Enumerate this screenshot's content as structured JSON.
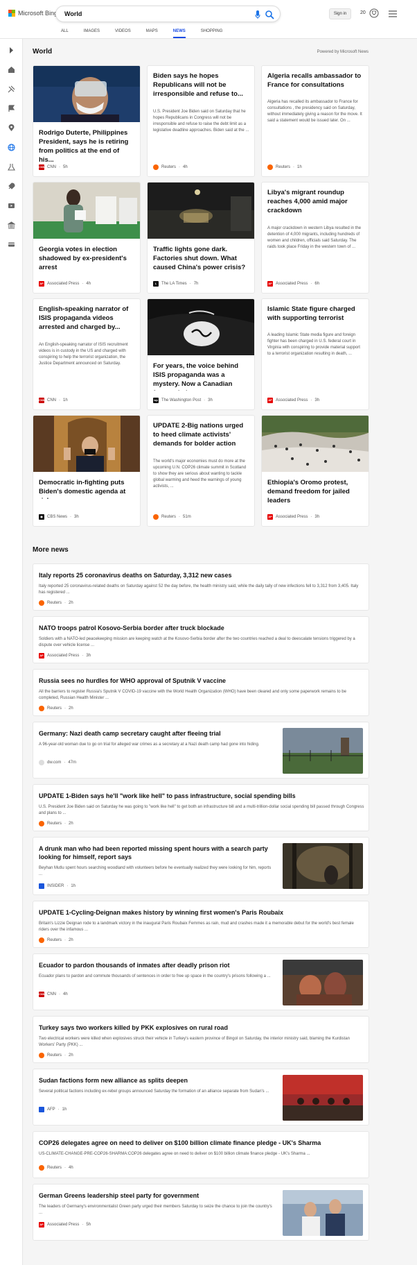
{
  "header": {
    "brand": "Microsoft Bing",
    "query": "World",
    "signin": "Sign in",
    "rewards_count": "20",
    "tabs": [
      {
        "label": "ALL"
      },
      {
        "label": "IMAGES"
      },
      {
        "label": "VIDEOS"
      },
      {
        "label": "MAPS"
      },
      {
        "label": "NEWS"
      },
      {
        "label": "SHOPPING"
      }
    ],
    "active_tab": "NEWS"
  },
  "rail": {
    "icons": [
      "expand-icon",
      "home-icon",
      "tools-icon",
      "flag-icon",
      "location-icon",
      "globe-icon",
      "science-icon",
      "rocket-icon",
      "video-icon",
      "bank-icon",
      "card-icon"
    ]
  },
  "section": {
    "title": "World",
    "powered_by": "Powered by Microsoft News"
  },
  "cards": [
    {
      "title": "Rodrigo Duterte, Philippines President, says he is retiring from politics at the end of his...",
      "source": "CNN",
      "time": "5h",
      "src_color": "#cc0000"
    },
    {
      "title": "Biden says he hopes Republicans will not be irresponsible and refuse to...",
      "desc": "U.S. President Joe Biden said on Saturday that he hopes Republicans in Congress will not be irresponsible and refuse to raise the debt limit as a legislative deadline approaches. Biden said at the ...",
      "source": "Reuters",
      "time": "4h",
      "src_color": "#fa6400"
    },
    {
      "title": "Algeria recalls ambassador to France for consultations",
      "desc": "Algeria has recalled its ambassador to France for consultations , the presidency said on Saturday, without immediately giving a reason for the move. It said a statement would be issued later. On ...",
      "source": "Reuters",
      "time": "1h",
      "src_color": "#fa6400"
    },
    {
      "title": "Georgia votes in election shadowed by ex-president's arrest",
      "source": "Associated Press",
      "time": "4h",
      "src_color": "#e60000"
    },
    {
      "title": "Traffic lights gone dark. Factories shut down. What caused China's power crisis?",
      "source": "The LA Times",
      "time": "7h",
      "src_color": "#111111"
    },
    {
      "title": "Libya's migrant roundup reaches 4,000 amid major crackdown",
      "desc": "A major crackdown in western Libya resulted in the detention of 4,000 migrants, including hundreds of women and children, officials said Saturday. The raids took place Friday in the western town of ...",
      "source": "Associated Press",
      "time": "6h",
      "src_color": "#e60000"
    },
    {
      "title": "English-speaking narrator of ISIS propaganda videos arrested and charged by...",
      "desc": "An English-speaking narrator of ISIS recruitment videos is in custody in the US and charged with conspiring to help the terrorist organization, the Justice Department announced on Saturday.",
      "source": "CNN",
      "time": "1h",
      "src_color": "#cc0000"
    },
    {
      "title": "For years, the voice behind ISIS propaganda was a mystery. Now a Canadian faces crimin...",
      "source": "The Washington Post",
      "time": "3h",
      "src_color": "#111111"
    },
    {
      "title": "Islamic State figure charged with supporting terrorist group",
      "desc": "A leading Islamic State media figure and foreign fighter has been charged in U.S. federal court in Virginia with conspiring to provide material support to a terrorist organization resulting in death, ...",
      "source": "Associated Press",
      "time": "3h",
      "src_color": "#e60000"
    },
    {
      "title": "Democratic in-fighting puts Biden's domestic agenda at risk",
      "source": "CBS News",
      "time": "3h",
      "src_color": "#111111"
    },
    {
      "title": "UPDATE 2-Big nations urged to heed climate activists' demands for bolder action",
      "desc": "The world's major economies must do more at the upcoming U.N. COP26 climate summit in Scotland to show they are serious about wanting to tackle global warming and heed the warnings of young activists, ...",
      "source": "Reuters",
      "time": "51m",
      "src_color": "#fa6400"
    },
    {
      "title": "Ethiopia's Oromo protest, demand freedom for jailed leaders",
      "source": "Associated Press",
      "time": "3h",
      "src_color": "#e60000"
    }
  ],
  "more": {
    "title": "More news",
    "items": [
      {
        "title": "Italy reports 25 coronavirus deaths on Saturday, 3,312 new cases",
        "desc": "Italy reported 25 coronavirus-related deaths on Saturday against 52 the day before, the health ministry said, while the daily tally of new infections fell to 3,312 from 3,405. Italy has registered ...",
        "source": "Reuters",
        "time": "2h",
        "src_color": "#fa6400"
      },
      {
        "title": "NATO troops patrol Kosovo-Serbia border after truck blockade",
        "desc": "Soldiers with a NATO-led peacekeeping mission are keeping watch at the Kosovo-Serbia border after the two countries reached a deal to deescalate tensions triggered by a dispute over vehicle license ...",
        "source": "Associated Press",
        "time": "3h",
        "src_color": "#e60000"
      },
      {
        "title": "Russia sees no hurdles for WHO approval of Sputnik V vaccine",
        "desc": "All the barriers to register Russia's Sputnik V COVID-19 vaccine with the World Health Organization (WHO) have been cleared and only some paperwork remains to be completed, Russian Health Minister ...",
        "source": "Reuters",
        "time": "2h",
        "src_color": "#fa6400"
      },
      {
        "title": "Germany: Nazi death camp secretary caught after fleeing trial",
        "desc": "A 96-year-old woman due to go on trial for alleged war crimes as a secretary at a Nazi death camp had gone into hiding.",
        "source": "dw.com",
        "time": "47m",
        "src_color": "#cccccc"
      },
      {
        "title": "UPDATE 1-Biden says he'll \"work like hell\" to pass infrastructure, social spending bills",
        "desc": "U.S. President Joe Biden said on Saturday he was going to \"work like hell\" to get both an infrastructure bill and a multi-trillion-dollar social spending bill passed through Congress and plans to ...",
        "source": "Reuters",
        "time": "2h",
        "src_color": "#fa6400"
      },
      {
        "title": "A drunk man who had been reported missing spent hours with a search party looking for himself, report says",
        "desc": "Beyhan Mutlu spent hours searching woodland with volunteers before he eventually realized they were looking for him, reports ...",
        "source": "INSIDER",
        "time": "1h",
        "src_color": "#1a56db"
      },
      {
        "title": "UPDATE 1-Cycling-Deignan makes history by winning first women's Paris Roubaix",
        "desc": "Britain's Lizzie Deignan rode to a landmark victory in the inaugural Paris Roubaix Femmes as rain, mud and crashes made it a memorable debut for the world's best female riders over the infamous ...",
        "source": "Reuters",
        "time": "2h",
        "src_color": "#fa6400"
      },
      {
        "title": "Ecuador to pardon thousands of inmates after deadly prison riot",
        "desc": "Ecuador plans to pardon and commute thousands of sentences in order to free up space in the country's prisons following a ...",
        "source": "CNN",
        "time": "4h",
        "src_color": "#cc0000"
      },
      {
        "title": "Turkey says two workers killed by PKK explosives on rural road",
        "desc": "Two electrical workers were killed when explosives struck their vehicle in Turkey's eastern province of Bingol on Saturday, the interior ministry said, blaming the Kurdistan Workers' Party (PKK) ...",
        "source": "Reuters",
        "time": "2h",
        "src_color": "#fa6400"
      },
      {
        "title": "Sudan factions form new alliance as splits deepen",
        "desc": "Several political factions including ex-rebel groups announced Saturday the formation of an alliance separate from Sudan's ...",
        "source": "AFP",
        "time": "1h",
        "src_color": "#1a56db"
      },
      {
        "title": "COP26 delegates agree on need to deliver on $100 billion climate finance pledge - UK's Sharma",
        "desc": "US-CLIMATE-CHANGE-PRE-COP26-SHARMA:COP26 delegates agree on need to deliver on $100 billion climate finance pledge - UK's Sharma ...",
        "source": "Reuters",
        "time": "4h",
        "src_color": "#fa6400"
      },
      {
        "title": "German Greens leadership steel party for government",
        "desc": "The leaders of Germany's environmentalist Green party urged their members Saturday to seize the chance to join the country's ...",
        "source": "Associated Press",
        "time": "5h",
        "src_color": "#e60000"
      }
    ]
  },
  "colors": {
    "accent": "#174ae4",
    "bing_blue": "#1a73e8"
  }
}
